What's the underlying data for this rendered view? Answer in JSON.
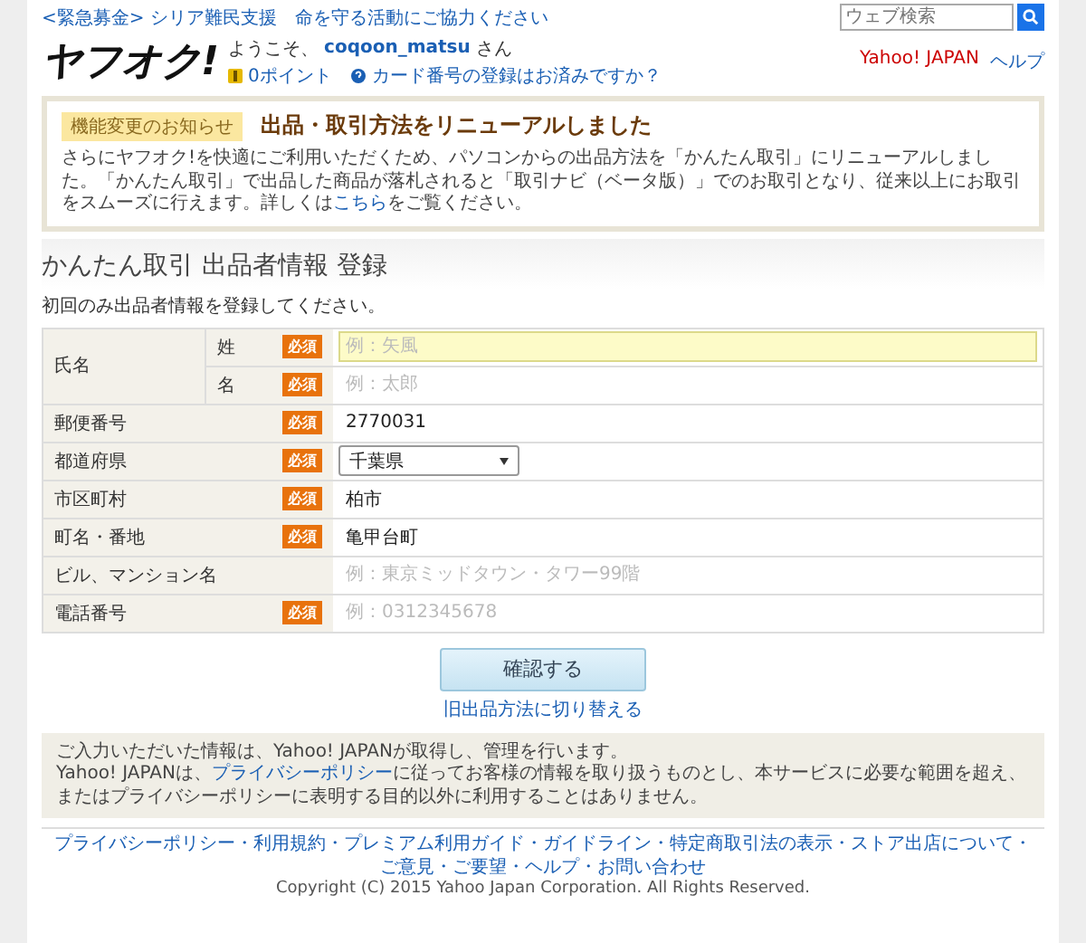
{
  "header": {
    "campaign_link": "<緊急募金> シリア難民支援　命を守る活動にご協力ください",
    "search": {
      "placeholder": "ウェブ検索"
    },
    "logo": "ヤフオク!",
    "welcome": "ようこそ、",
    "username": "coqoon_matsu",
    "honorific": "さん",
    "points": "0ポイント",
    "card_link": "カード番号の登録はお済みですか？",
    "right_links": [
      "Yahoo! JAPAN",
      "ヘルプ"
    ]
  },
  "notice": {
    "tag": "機能変更のお知らせ",
    "title": "出品・取引方法をリニューアルしました",
    "text_before": "さらにヤフオク!を快適にご利用いただくため、パソコンからの出品方法を「かんたん取引」にリニューアルしました。「かんたん取引」で出品した商品が落札されると「取引ナビ（ベータ版）」でのお取引となり、従来以上にお取引をスムーズに行えます。詳しくは",
    "link": "こちら",
    "text_after": "をご覧ください。"
  },
  "page_title": "かんたん取引 出品者情報 登録",
  "instruction": "初回のみ出品者情報を登録してください。",
  "form": {
    "rows": [
      {
        "kind": "name",
        "label": "氏名",
        "parts": [
          {
            "label": "姓",
            "badge": "必須",
            "placeholder": "例：矢風",
            "focused": true
          },
          {
            "label": "名",
            "badge": "必須",
            "placeholder": "例：太郎",
            "focused": false
          }
        ]
      },
      {
        "kind": "text",
        "label": "郵便番号",
        "badge": "必須",
        "value": "2770031"
      },
      {
        "kind": "select",
        "label": "都道府県",
        "badge": "必須",
        "value": "千葉県"
      },
      {
        "kind": "text",
        "label": "市区町村",
        "badge": "必須",
        "value": "柏市"
      },
      {
        "kind": "text",
        "label": "町名・番地",
        "badge": "必須",
        "value": "亀甲台町"
      },
      {
        "kind": "text",
        "label": "ビル、マンション名",
        "placeholder": "例：東京ミッドタウン・タワー99階"
      },
      {
        "kind": "text",
        "label": "電話番号",
        "badge": "必須",
        "placeholder": "例：0312345678"
      }
    ]
  },
  "confirm_button": "確認する",
  "switch_link": "旧出品方法に切り替える",
  "privacy": {
    "line1": "ご入力いただいた情報は、Yahoo! JAPANが取得し、管理を行います。",
    "text_before": "Yahoo! JAPANは、",
    "link": "プライバシーポリシー",
    "text_after": "に従ってお客様の情報を取り扱うものとし、本サービスに必要な範囲を超え、またはプライバシーポリシーに表明する目的以外に利用することはありません。"
  },
  "footer": {
    "links": [
      {
        "label": "プライバシーポリシー",
        "sep": "・"
      },
      {
        "label": "利用規約",
        "sep": "・"
      },
      {
        "label": "プレミアム利用ガイド",
        "sep": "・"
      },
      {
        "label": "ガイドライン",
        "sep": "・"
      },
      {
        "label": "特定商取引法の表示",
        "sep": "・"
      },
      {
        "label": "ストア出店について",
        "sep": "・"
      },
      {
        "label": "ご意見・ご要望",
        "sep": "・"
      },
      {
        "label": "ヘルプ",
        "sep": "・"
      },
      {
        "label": "お問い合わせ"
      }
    ],
    "copyright": "Copyright (C) 2015 Yahoo Japan Corporation. All Rights Reserved."
  }
}
